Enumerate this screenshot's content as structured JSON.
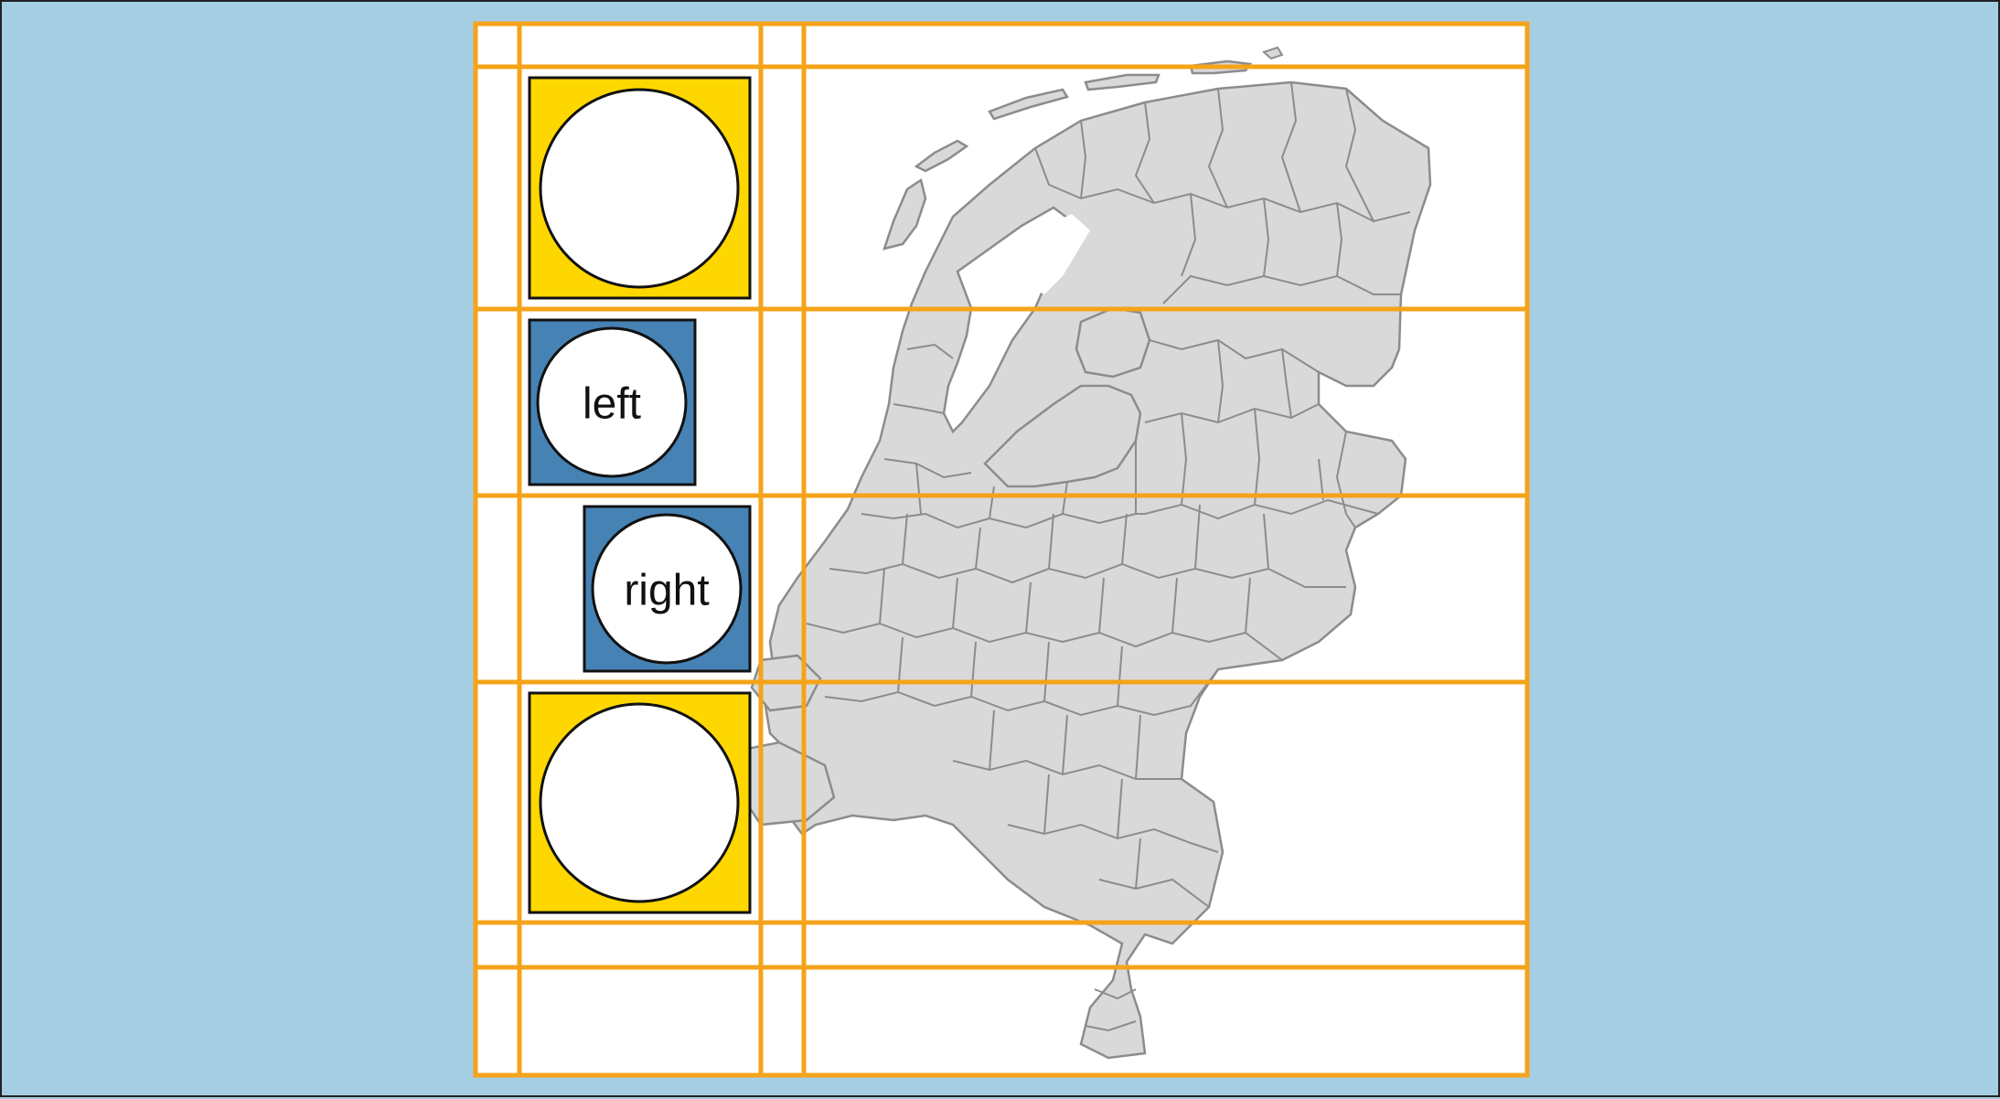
{
  "colors": {
    "background": "#a6cee3",
    "map_fill": "#d9d9d9",
    "map_border": "#8c8c8c",
    "grid": "#f5a31a",
    "panel": "#ffffff",
    "symbol_yellow": "#ffd700",
    "symbol_blue": "#4682b4",
    "circle": "#ffffff"
  },
  "legend": {
    "cells": [
      {
        "name": "legend-cell-top",
        "box_color": "symbol_yellow",
        "label": ""
      },
      {
        "name": "legend-cell-left",
        "box_color": "symbol_blue",
        "label": "left"
      },
      {
        "name": "legend-cell-right",
        "box_color": "symbol_blue",
        "label": "right"
      },
      {
        "name": "legend-cell-bottom",
        "box_color": "symbol_yellow",
        "label": ""
      }
    ]
  }
}
